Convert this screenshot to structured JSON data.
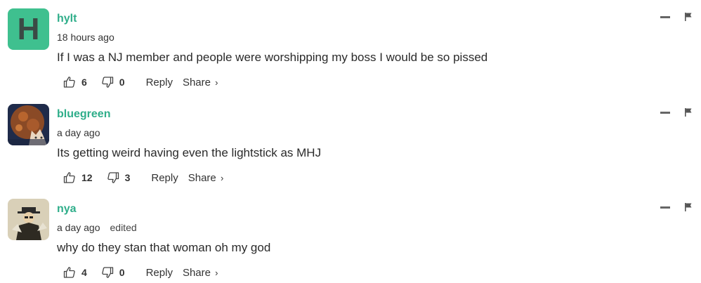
{
  "comments": [
    {
      "username": "hylt",
      "avatar_letter": "H",
      "time": "18 hours ago",
      "edited": "",
      "text": "If I was a NJ member and people were worshipping my boss I would be so pissed",
      "likes": "6",
      "dislikes": "0"
    },
    {
      "username": "bluegreen",
      "avatar_letter": "",
      "time": "a day ago",
      "edited": "",
      "text": "Its getting weird having even the lightstick as MHJ",
      "likes": "12",
      "dislikes": "3"
    },
    {
      "username": "nya",
      "avatar_letter": "",
      "time": "a day ago",
      "edited": "edited",
      "text": "why do they stan that woman oh my god",
      "likes": "4",
      "dislikes": "0"
    }
  ],
  "labels": {
    "reply": "Reply",
    "share": "Share",
    "share_chevron": "›"
  },
  "colors": {
    "username": "#2fae8a",
    "avatar_h_bg": "#3fc08f",
    "icon": "#444444"
  },
  "icons": {
    "like": "thumbs-up-icon",
    "dislike": "thumbs-down-icon",
    "collapse": "minus-icon",
    "report": "flag-icon"
  }
}
